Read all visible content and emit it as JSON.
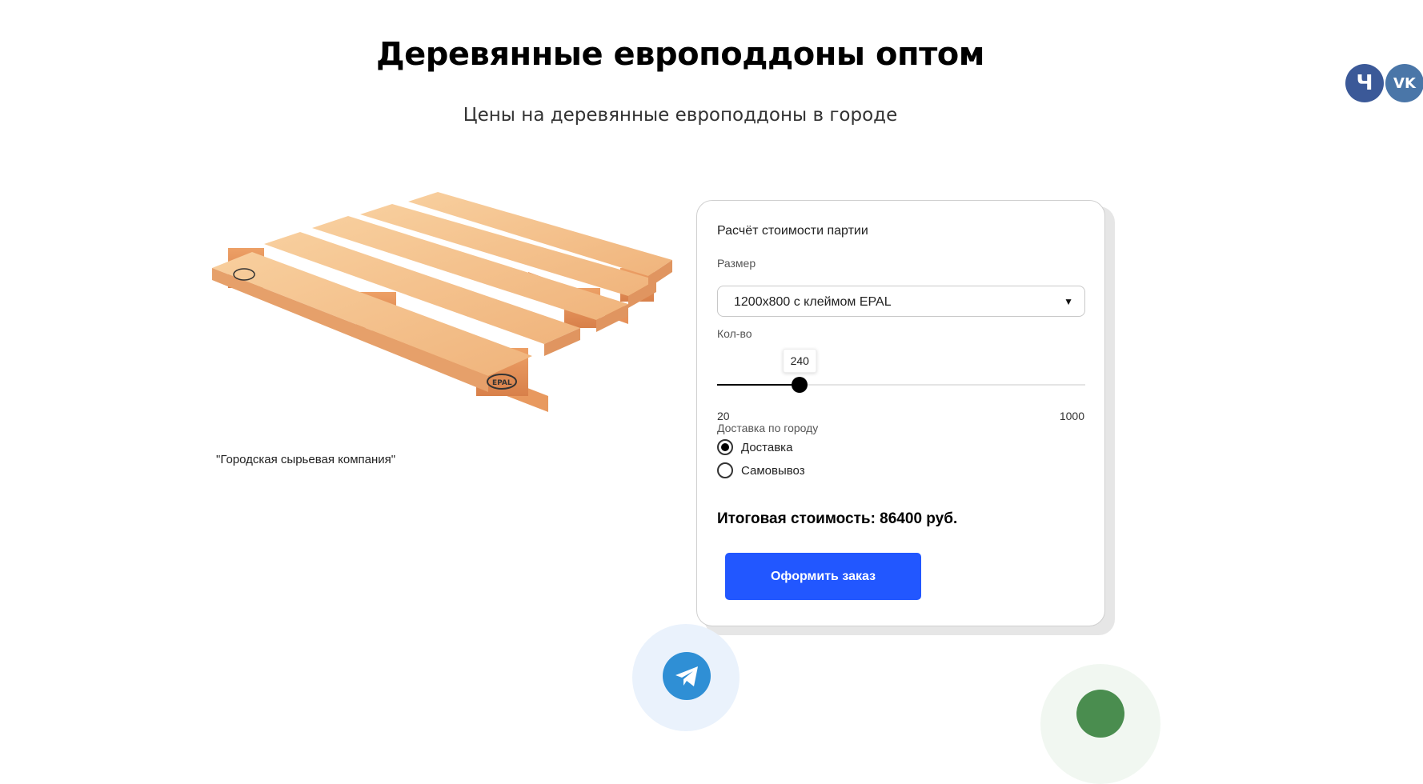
{
  "page": {
    "title": "Деревянные европоддоны оптом",
    "subtitle": "Цены на деревянные европоддоны в городе"
  },
  "social": [
    {
      "name": "ch-icon",
      "glyph": "Ч"
    },
    {
      "name": "vk-icon",
      "glyph": "VK"
    }
  ],
  "product": {
    "image": "pallet",
    "stamp": "EPAL",
    "caption": "\"Городская сырьевая компания\""
  },
  "calculator": {
    "title": "Расчёт стоимости партии",
    "size_label": "Размер",
    "size_value": "1200х800 с клеймом EPAL",
    "qty_label": "Кол-во",
    "qty_value": "240",
    "qty_min": "20",
    "qty_max": "1000",
    "delivery_label": "Доставка по городу",
    "options": [
      {
        "label": "Доставка",
        "checked": true
      },
      {
        "label": "Самовывоз",
        "checked": false
      }
    ],
    "total": "Итоговая стоимость: 86400 руб.",
    "order_button": "Оформить заказ"
  },
  "colors": {
    "accent": "#2257ff",
    "telegram": "#2f8fd5",
    "whatsapp": "#4a8d4f",
    "vk": "#4a76a8",
    "ch": "#3b5998"
  }
}
